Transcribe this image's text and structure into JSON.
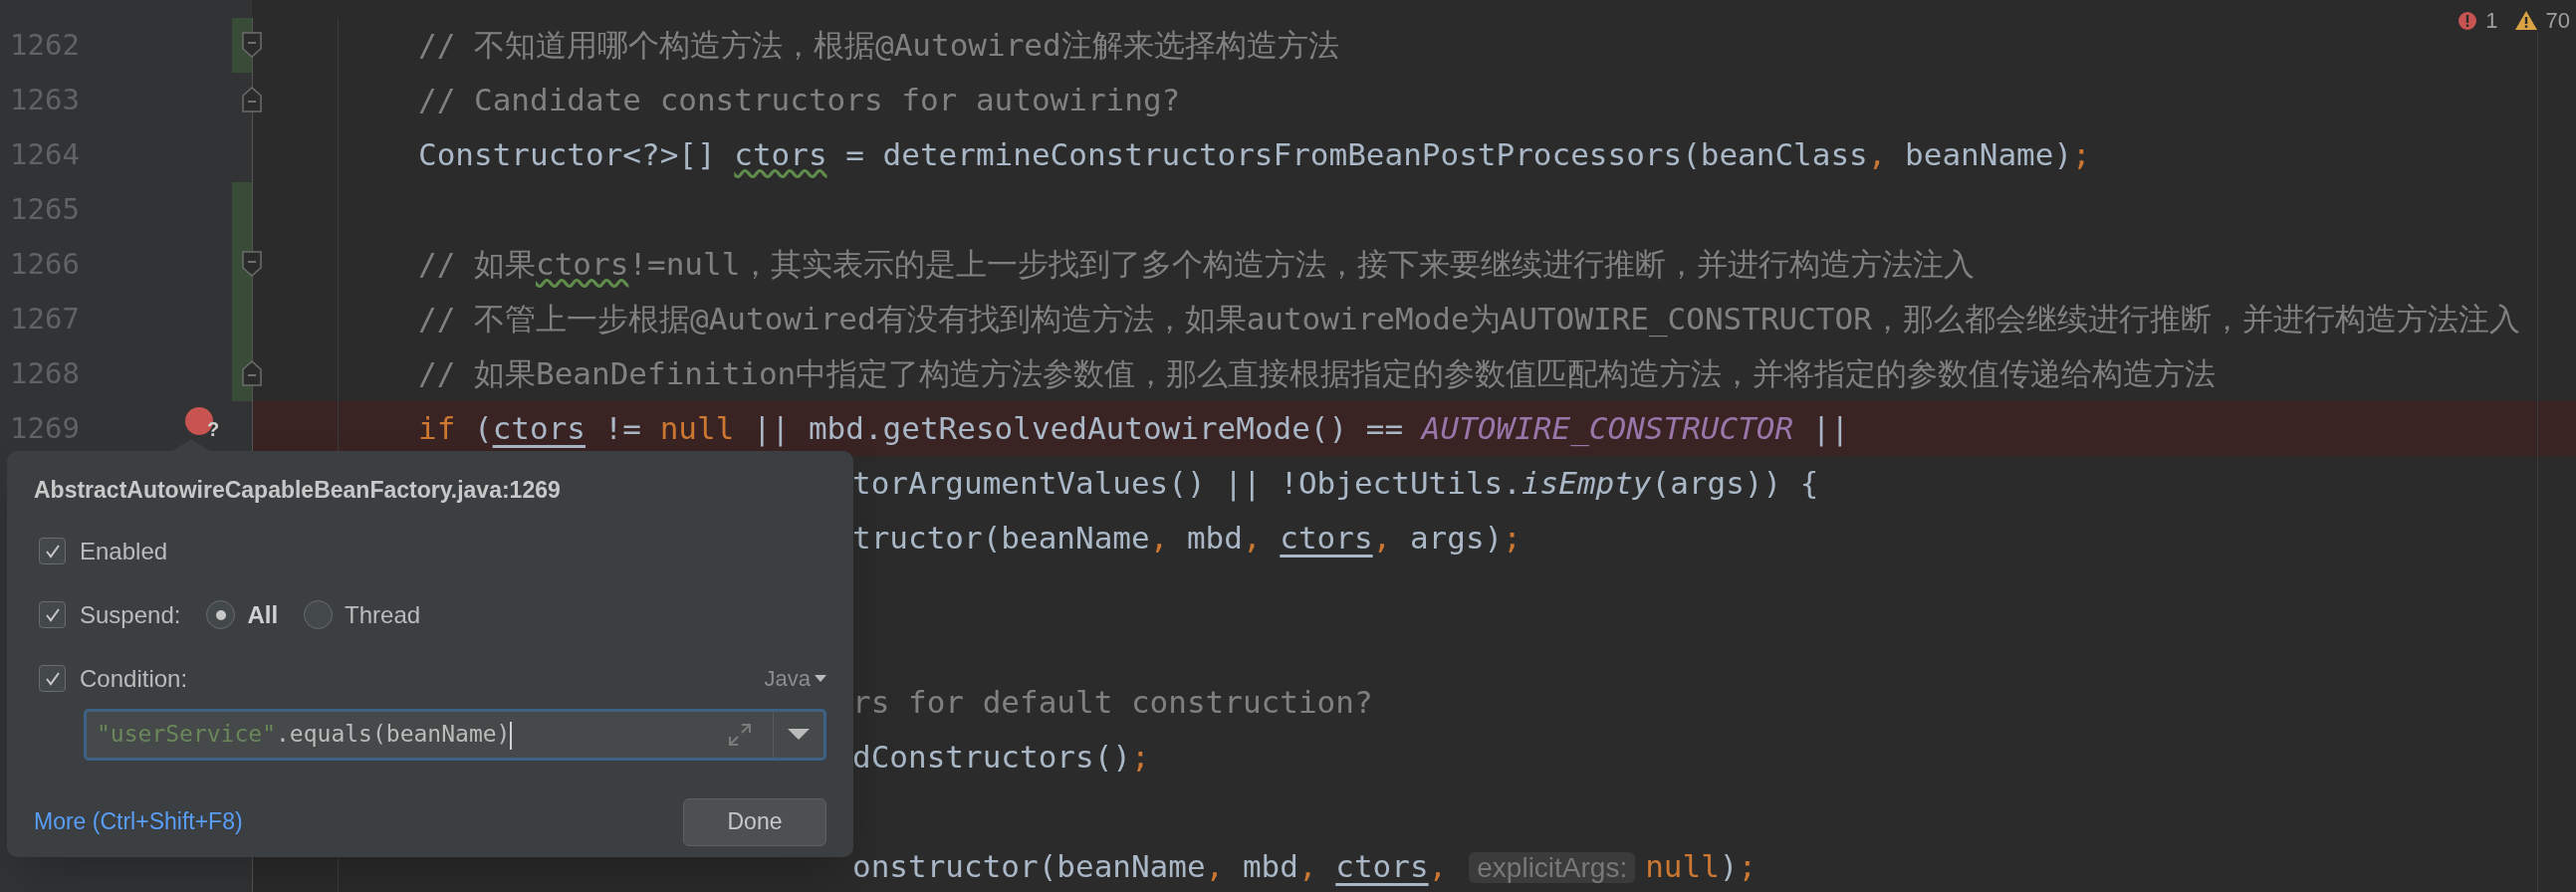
{
  "editor": {
    "problems": {
      "errors": "1",
      "warnings": "70"
    },
    "lines": [
      {
        "number": "1262",
        "changed": true,
        "fold_start": true,
        "fold_end": false,
        "breakpoint": false,
        "tokens": [
          {
            "kind": "comment",
            "text": "// 不知道用哪个构造方法，根据@Autowired注解来选择构造方法"
          }
        ]
      },
      {
        "number": "1263",
        "changed": false,
        "fold_start": false,
        "fold_end": true,
        "breakpoint": false,
        "tokens": [
          {
            "kind": "comment",
            "text": "// Candidate constructors for autowiring?"
          }
        ]
      },
      {
        "number": "1264",
        "changed": false,
        "fold_start": false,
        "fold_end": false,
        "breakpoint": false,
        "tokens": [
          {
            "kind": "plain",
            "text": "Constructor<?>[] "
          },
          {
            "kind": "squiggle",
            "text": "ctors"
          },
          {
            "kind": "plain",
            "text": " = determineConstructorsFromBeanPostProcessors(beanClass"
          },
          {
            "kind": "punct",
            "text": ","
          },
          {
            "kind": "plain",
            "text": " beanName)"
          },
          {
            "kind": "punct",
            "text": ";"
          }
        ]
      },
      {
        "number": "1265",
        "changed": true,
        "fold_start": false,
        "fold_end": false,
        "breakpoint": false
      },
      {
        "number": "1266",
        "changed": true,
        "fold_start": true,
        "fold_end": false,
        "breakpoint": false,
        "tokens": [
          {
            "kind": "comment",
            "text": "// 如果"
          },
          {
            "kind": "comment-squiggle",
            "text": "ctors"
          },
          {
            "kind": "comment",
            "text": "!=null，其实表示的是上一步找到了多个构造方法，接下来要继续进行推断，并进行构造方法注入"
          }
        ]
      },
      {
        "number": "1267",
        "changed": true,
        "fold_start": false,
        "fold_end": false,
        "breakpoint": false,
        "tokens": [
          {
            "kind": "comment",
            "text": "// 不管上一步根据@Autowired有没有找到构造方法，如果autowireMode为AUTOWIRE_CONSTRUCTOR，那么都会继续进行推断，并进行构造方法注入"
          }
        ]
      },
      {
        "number": "1268",
        "changed": true,
        "fold_start": false,
        "fold_end": true,
        "breakpoint": false,
        "tokens": [
          {
            "kind": "comment",
            "text": "// 如果BeanDefinition中指定了构造方法参数值，那么直接根据指定的参数值匹配构造方法，并将指定的参数值传递给构造方法"
          }
        ]
      },
      {
        "number": "1269",
        "changed": false,
        "fold_start": false,
        "fold_end": false,
        "breakpoint": true,
        "breakpoint_label": "?",
        "tokens": [
          {
            "kind": "keyword",
            "text": "if"
          },
          {
            "kind": "plain",
            "text": " ("
          },
          {
            "kind": "underline",
            "text": "ctors"
          },
          {
            "kind": "plain",
            "text": " != "
          },
          {
            "kind": "keyword",
            "text": "null"
          },
          {
            "kind": "plain",
            "text": " || mbd.getResolvedAutowireMode() == "
          },
          {
            "kind": "constant",
            "text": "AUTOWIRE_CONSTRUCTOR"
          },
          {
            "kind": "plain",
            "text": " ||"
          }
        ]
      }
    ],
    "lines_under_popup": [
      {
        "kind": "code",
        "tokens": [
          {
            "kind": "plain",
            "text": "torArgumentValues() || !ObjectUtils."
          },
          {
            "kind": "italic",
            "text": "isEmpty"
          },
          {
            "kind": "plain",
            "text": "(args)) {"
          }
        ]
      },
      {
        "kind": "code",
        "tokens": [
          {
            "kind": "plain",
            "text": "tructor(beanName"
          },
          {
            "kind": "punct",
            "text": ","
          },
          {
            "kind": "plain",
            "text": " mbd"
          },
          {
            "kind": "punct",
            "text": ", "
          },
          {
            "kind": "underline",
            "text": "ctors"
          },
          {
            "kind": "punct",
            "text": ","
          },
          {
            "kind": "plain",
            "text": " args)"
          },
          {
            "kind": "punct",
            "text": ";"
          }
        ]
      },
      {
        "kind": "blank"
      },
      {
        "kind": "blank"
      },
      {
        "kind": "code",
        "tokens": [
          {
            "kind": "comment",
            "text": "rs for default construction?"
          }
        ]
      },
      {
        "kind": "code",
        "tokens": [
          {
            "kind": "plain",
            "text": "dConstructors()"
          },
          {
            "kind": "punct",
            "text": ";"
          }
        ]
      },
      {
        "kind": "blank"
      },
      {
        "kind": "code",
        "tokens": [
          {
            "kind": "plain",
            "text": "onstructor(beanName"
          },
          {
            "kind": "punct",
            "text": ","
          },
          {
            "kind": "plain",
            "text": " mbd"
          },
          {
            "kind": "punct",
            "text": ", "
          },
          {
            "kind": "underline",
            "text": "ctors"
          },
          {
            "kind": "punct",
            "text": ","
          },
          {
            "kind": "hint",
            "text": "explicitArgs:"
          },
          {
            "kind": "keyword",
            "text": "null"
          },
          {
            "kind": "plain",
            "text": ")"
          },
          {
            "kind": "punct",
            "text": ";"
          }
        ]
      }
    ]
  },
  "breakpoint_popup": {
    "title": "AbstractAutowireCapableBeanFactory.java:1269",
    "enabled": {
      "label": "Enabled",
      "checked": true
    },
    "suspend": {
      "label": "Suspend:",
      "checked": true,
      "options": [
        {
          "label": "All",
          "selected": true
        },
        {
          "label": "Thread",
          "selected": false
        }
      ]
    },
    "condition": {
      "label": "Condition:",
      "checked": true,
      "language": "Java",
      "string_part": "\"userService\"",
      "code_part": ".equals(beanName)"
    },
    "more_link": "More (Ctrl+Shift+F8)",
    "done_button": "Done"
  }
}
